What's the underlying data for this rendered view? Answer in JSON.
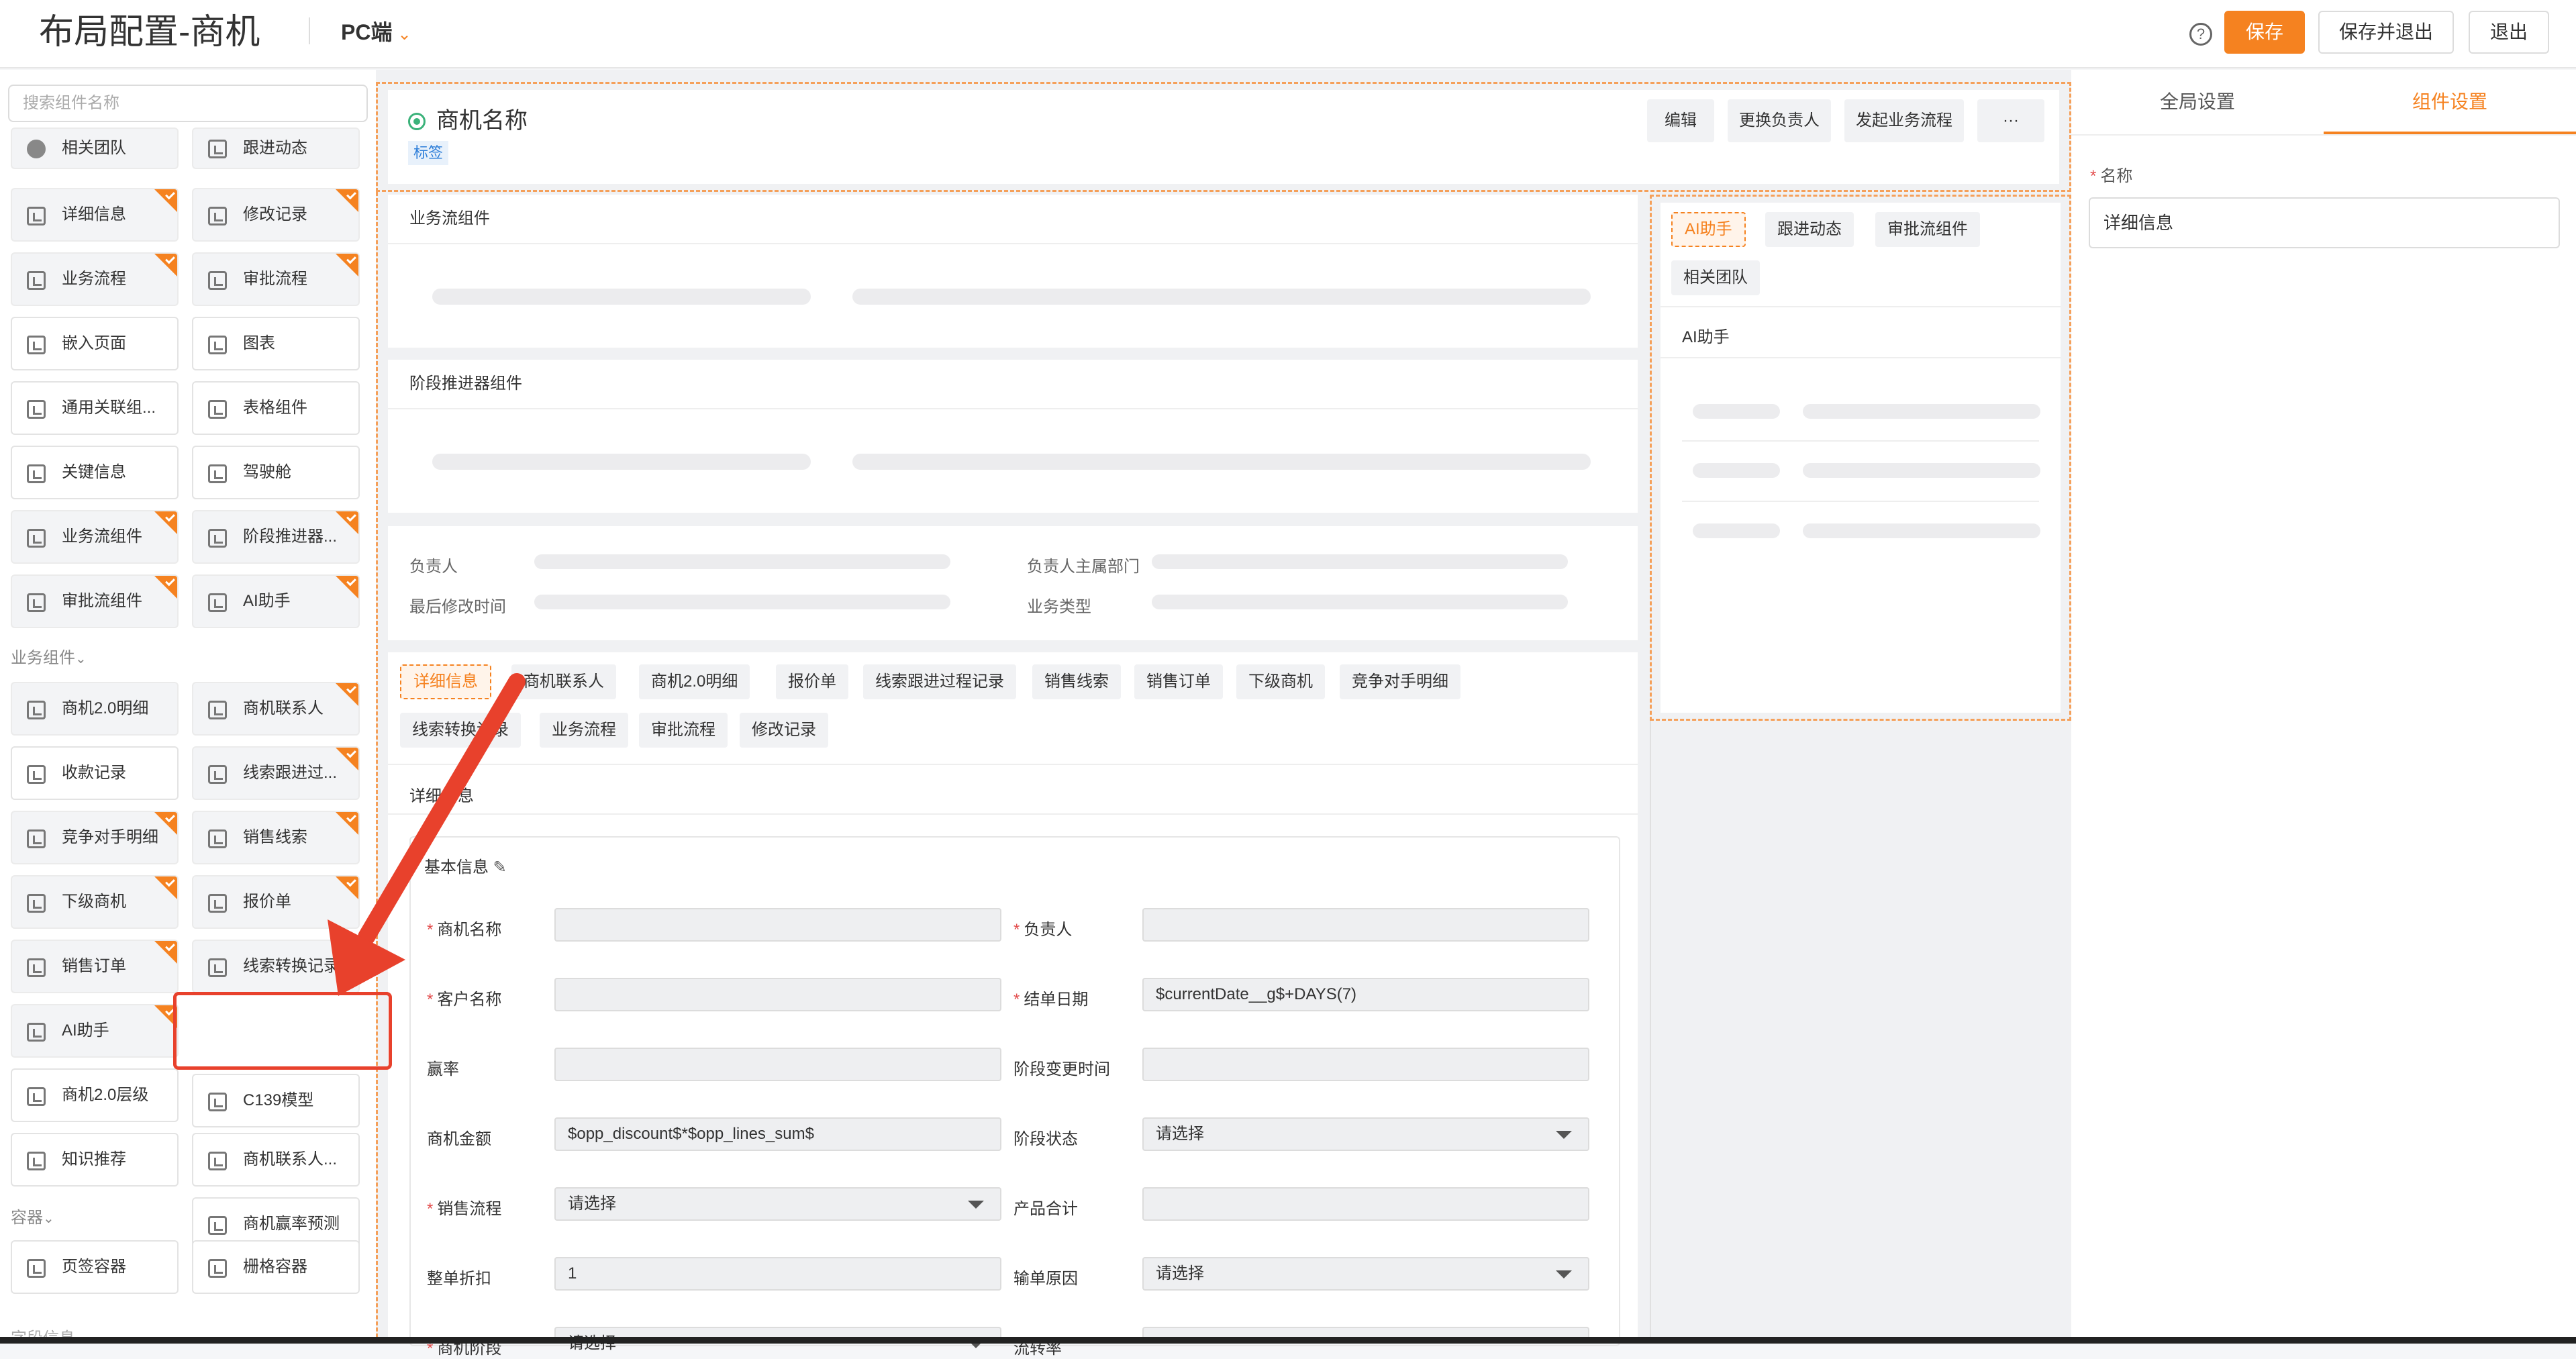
{
  "header": {
    "title": "布局配置-商机",
    "platform": "PC端",
    "help": "?",
    "save": "保存",
    "save_exit": "保存并退出",
    "exit": "退出"
  },
  "left": {
    "search_placeholder": "搜索组件名称",
    "items": [
      {
        "label": "相关团队"
      },
      {
        "label": "跟进动态"
      },
      {
        "label": "详细信息"
      },
      {
        "label": "修改记录"
      },
      {
        "label": "业务流程"
      },
      {
        "label": "审批流程"
      },
      {
        "label": "嵌入页面"
      },
      {
        "label": "图表"
      },
      {
        "label": "通用关联组..."
      },
      {
        "label": "表格组件"
      },
      {
        "label": "关键信息"
      },
      {
        "label": "驾驶舱"
      },
      {
        "label": "业务流组件"
      },
      {
        "label": "阶段推进器..."
      },
      {
        "label": "审批流组件"
      },
      {
        "label": "AI助手"
      }
    ],
    "group_business": "业务组件",
    "business_items": [
      {
        "label": "商机2.0明细"
      },
      {
        "label": "商机联系人"
      },
      {
        "label": "收款记录"
      },
      {
        "label": "线索跟进过..."
      },
      {
        "label": "竞争对手明细"
      },
      {
        "label": "销售线索"
      },
      {
        "label": "下级商机"
      },
      {
        "label": "报价单"
      },
      {
        "label": "销售订单"
      },
      {
        "label": "线索转换记录"
      },
      {
        "label": "AI助手"
      },
      {
        "label": "C139模型"
      },
      {
        "label": "商机2.0层级"
      },
      {
        "label": "商机联系人..."
      },
      {
        "label": "知识推荐"
      },
      {
        "label": "商机赢率预测"
      }
    ],
    "group_container": "容器",
    "container_items": [
      {
        "label": "页签容器"
      },
      {
        "label": "栅格容器"
      }
    ],
    "group_field": "字段信息"
  },
  "canvas": {
    "name_title": "商机名称",
    "name_tag": "标签",
    "top_buttons": [
      "编辑",
      "更换负责人",
      "发起业务流程",
      "···"
    ],
    "section_flow": "业务流组件",
    "section_stage": "阶段推进器组件",
    "key_fields": [
      "负责人",
      "负责人主属部门",
      "最后修改时间",
      "业务类型"
    ],
    "tabs": [
      "详细信息",
      "商机联系人",
      "商机2.0明细",
      "报价单",
      "线索跟进过程记录",
      "销售线索",
      "销售订单",
      "下级商机",
      "竞争对手明细",
      "线索转换记录",
      "业务流程",
      "审批流程",
      "修改记录"
    ],
    "detail_head": "详细信息",
    "basic_info": "基本信息",
    "form": [
      {
        "label": "商机名称",
        "req": true,
        "value": "",
        "select": false
      },
      {
        "label": "负责人",
        "req": true,
        "value": "",
        "select": false
      },
      {
        "label": "客户名称",
        "req": true,
        "value": "",
        "select": false
      },
      {
        "label": "结单日期",
        "req": true,
        "value": "$currentDate__g$+DAYS(7)",
        "select": false
      },
      {
        "label": "赢率",
        "req": false,
        "value": "",
        "select": false
      },
      {
        "label": "阶段变更时间",
        "req": false,
        "value": "",
        "select": false
      },
      {
        "label": "商机金额",
        "req": false,
        "value": "$opp_discount$*$opp_lines_sum$",
        "select": false
      },
      {
        "label": "阶段状态",
        "req": false,
        "value": "请选择",
        "select": true
      },
      {
        "label": "销售流程",
        "req": true,
        "value": "请选择",
        "select": true
      },
      {
        "label": "产品合计",
        "req": false,
        "value": "",
        "select": false
      },
      {
        "label": "整单折扣",
        "req": false,
        "value": "1",
        "select": false
      },
      {
        "label": "输单原因",
        "req": false,
        "value": "请选择",
        "select": true
      },
      {
        "label": "商机阶段",
        "req": true,
        "value": "请选择",
        "select": true
      },
      {
        "label": "流转率",
        "req": false,
        "value": "",
        "select": false
      }
    ],
    "side_tabs": [
      "AI助手",
      "跟进动态",
      "审批流组件",
      "相关团队"
    ],
    "side_head": "AI助手"
  },
  "right": {
    "tab_global": "全局设置",
    "tab_component": "组件设置",
    "name_label": "名称",
    "name_value": "详细信息"
  },
  "colors": {
    "accent": "#f58220",
    "annotation": "#e8412c"
  }
}
